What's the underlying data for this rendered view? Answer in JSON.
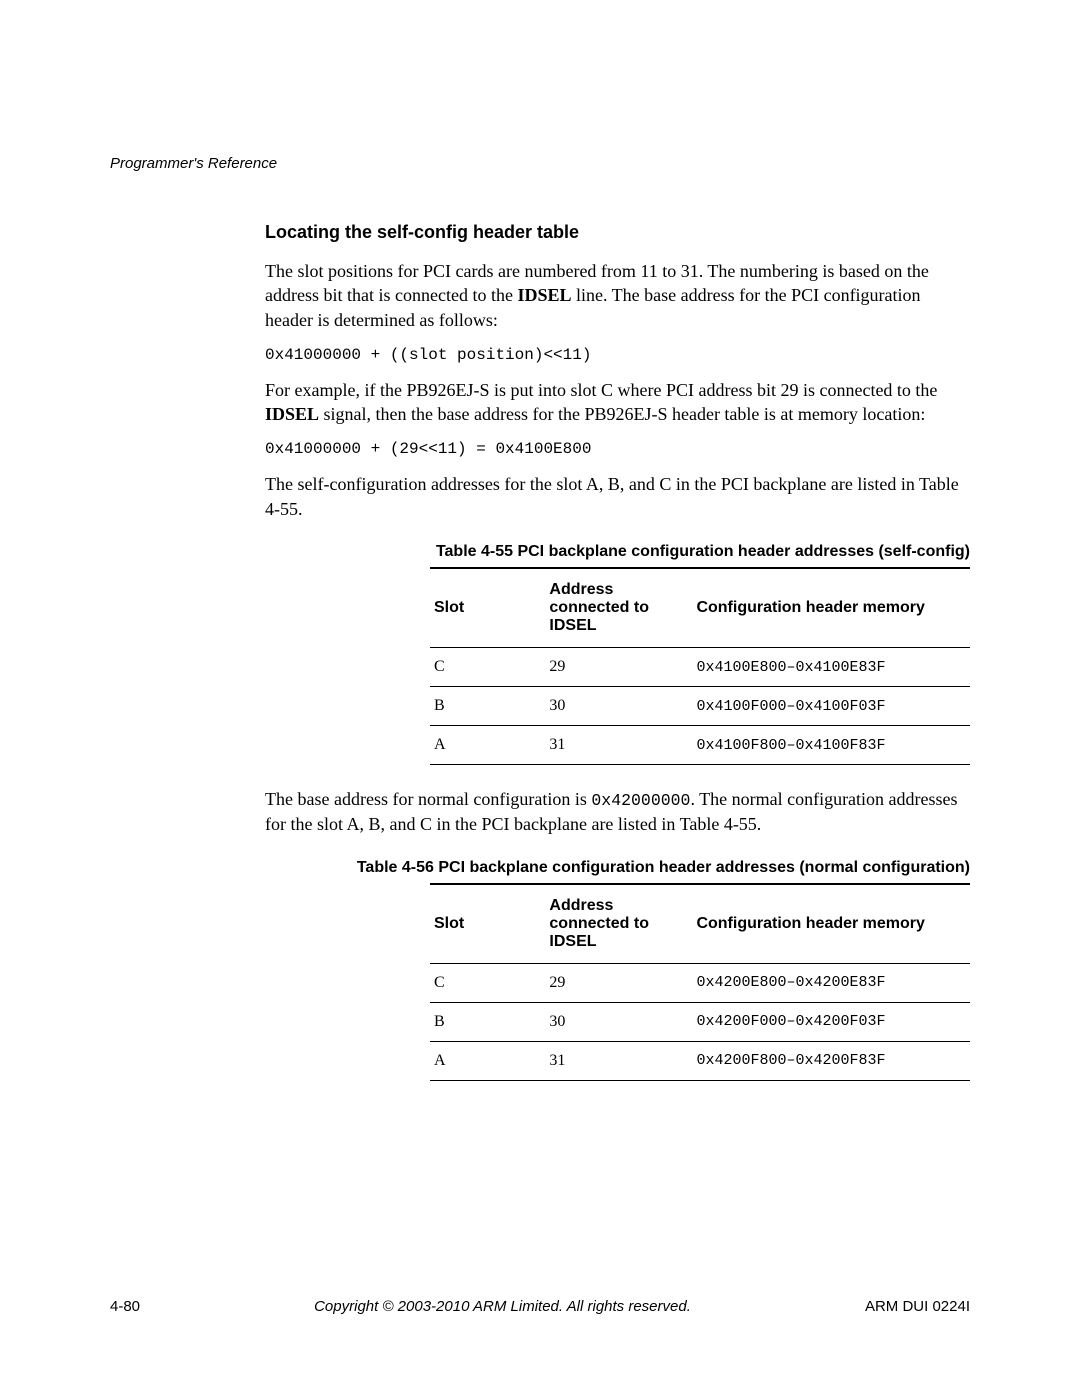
{
  "header": {
    "breadcrumb": "Programmer's Reference"
  },
  "section": {
    "heading": "Locating the self-config header table",
    "para1_pre": "The slot positions for PCI cards are numbered from 11 to 31. The numbering is based on the address bit that is connected to the ",
    "para1_bold": "IDSEL",
    "para1_post": " line. The base address for the PCI configuration header is determined as follows:",
    "code1": "0x41000000 + ((slot position)<<11)",
    "para2_pre": "For example, if the PB926EJ-S is put into slot C where PCI address bit 29 is connected to the ",
    "para2_bold": "IDSEL",
    "para2_post": " signal, then the base address for the PB926EJ-S header table is at memory location:",
    "code2": "0x41000000 + (29<<11) = 0x4100E800",
    "para3": "The self-configuration addresses for the slot A, B, and C in the PCI backplane are listed in Table 4-55.",
    "para4_pre": "The base address for normal configuration is ",
    "para4_code": "0x42000000",
    "para4_post": ". The normal configuration addresses for the slot A, B, and C in the PCI backplane are listed in Table 4-55."
  },
  "table55": {
    "caption": "Table 4-55 PCI backplane configuration header addresses (self-config)",
    "headers": {
      "slot": "Slot",
      "addr": "Address connected to IDSEL",
      "mem": "Configuration header memory"
    },
    "rows": [
      {
        "slot": "C",
        "addr": "29",
        "mem": "0x4100E800–0x4100E83F"
      },
      {
        "slot": "B",
        "addr": "30",
        "mem": "0x4100F000–0x4100F03F"
      },
      {
        "slot": "A",
        "addr": "31",
        "mem": "0x4100F800–0x4100F83F"
      }
    ]
  },
  "table56": {
    "caption": "Table 4-56 PCI backplane configuration header addresses (normal configuration)",
    "headers": {
      "slot": "Slot",
      "addr": "Address connected to IDSEL",
      "mem": "Configuration header memory"
    },
    "rows": [
      {
        "slot": "C",
        "addr": "29",
        "mem": "0x4200E800–0x4200E83F"
      },
      {
        "slot": "B",
        "addr": "30",
        "mem": "0x4200F000–0x4200F03F"
      },
      {
        "slot": "A",
        "addr": "31",
        "mem": "0x4200F800–0x4200F83F"
      }
    ]
  },
  "footer": {
    "page": "4-80",
    "copyright": "Copyright © 2003-2010 ARM Limited. All rights reserved.",
    "docref": "ARM DUI 0224I"
  }
}
